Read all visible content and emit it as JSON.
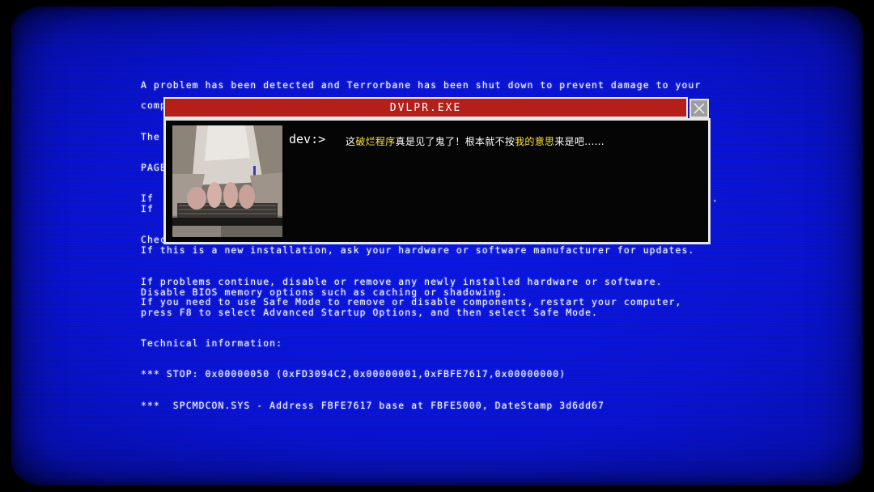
{
  "bsod": {
    "line1": "A problem has been detected and Terrorbane has been shut down to prevent damage to your",
    "line2": "comp",
    "line3": "The",
    "line4": "PAGE",
    "line5a": "If",
    "line5b": "If",
    "line5_tail": ".",
    "line6": "Chec",
    "line7": "If this is a new installation, ask your hardware or software manufacturer for updates.",
    "line8": "If problems continue, disable or remove any newly installed hardware or software.",
    "line9": "Disable BIOS memory options such as caching or shadowing.",
    "line10": "If you need to use Safe Mode to remove or disable components, restart your computer,",
    "line11": "press F8 to select Advanced Startup Options, and then select Safe Mode.",
    "line12": "Technical information:",
    "line13": "*** STOP: 0x00000050 (0xFD3094C2,0x00000001,0xFBFE7617,0x00000000)",
    "line14": "***  SPCMDCON.SYS - Address FBFE7617 base at FBFE5000, DateStamp 3d6dd67"
  },
  "dialog": {
    "title": "DVLPR.EXE",
    "prompt": "dev:>",
    "message_parts": {
      "p1": "这",
      "p2": "破烂程序",
      "p3": "真是见了鬼了！根本就不按",
      "p4": "我的意思",
      "p5": "来是吧......"
    }
  },
  "colors": {
    "screen_blue": "#0a14d2",
    "title_red": "#b51f1a",
    "highlight_yellow": "#ffe43a"
  }
}
